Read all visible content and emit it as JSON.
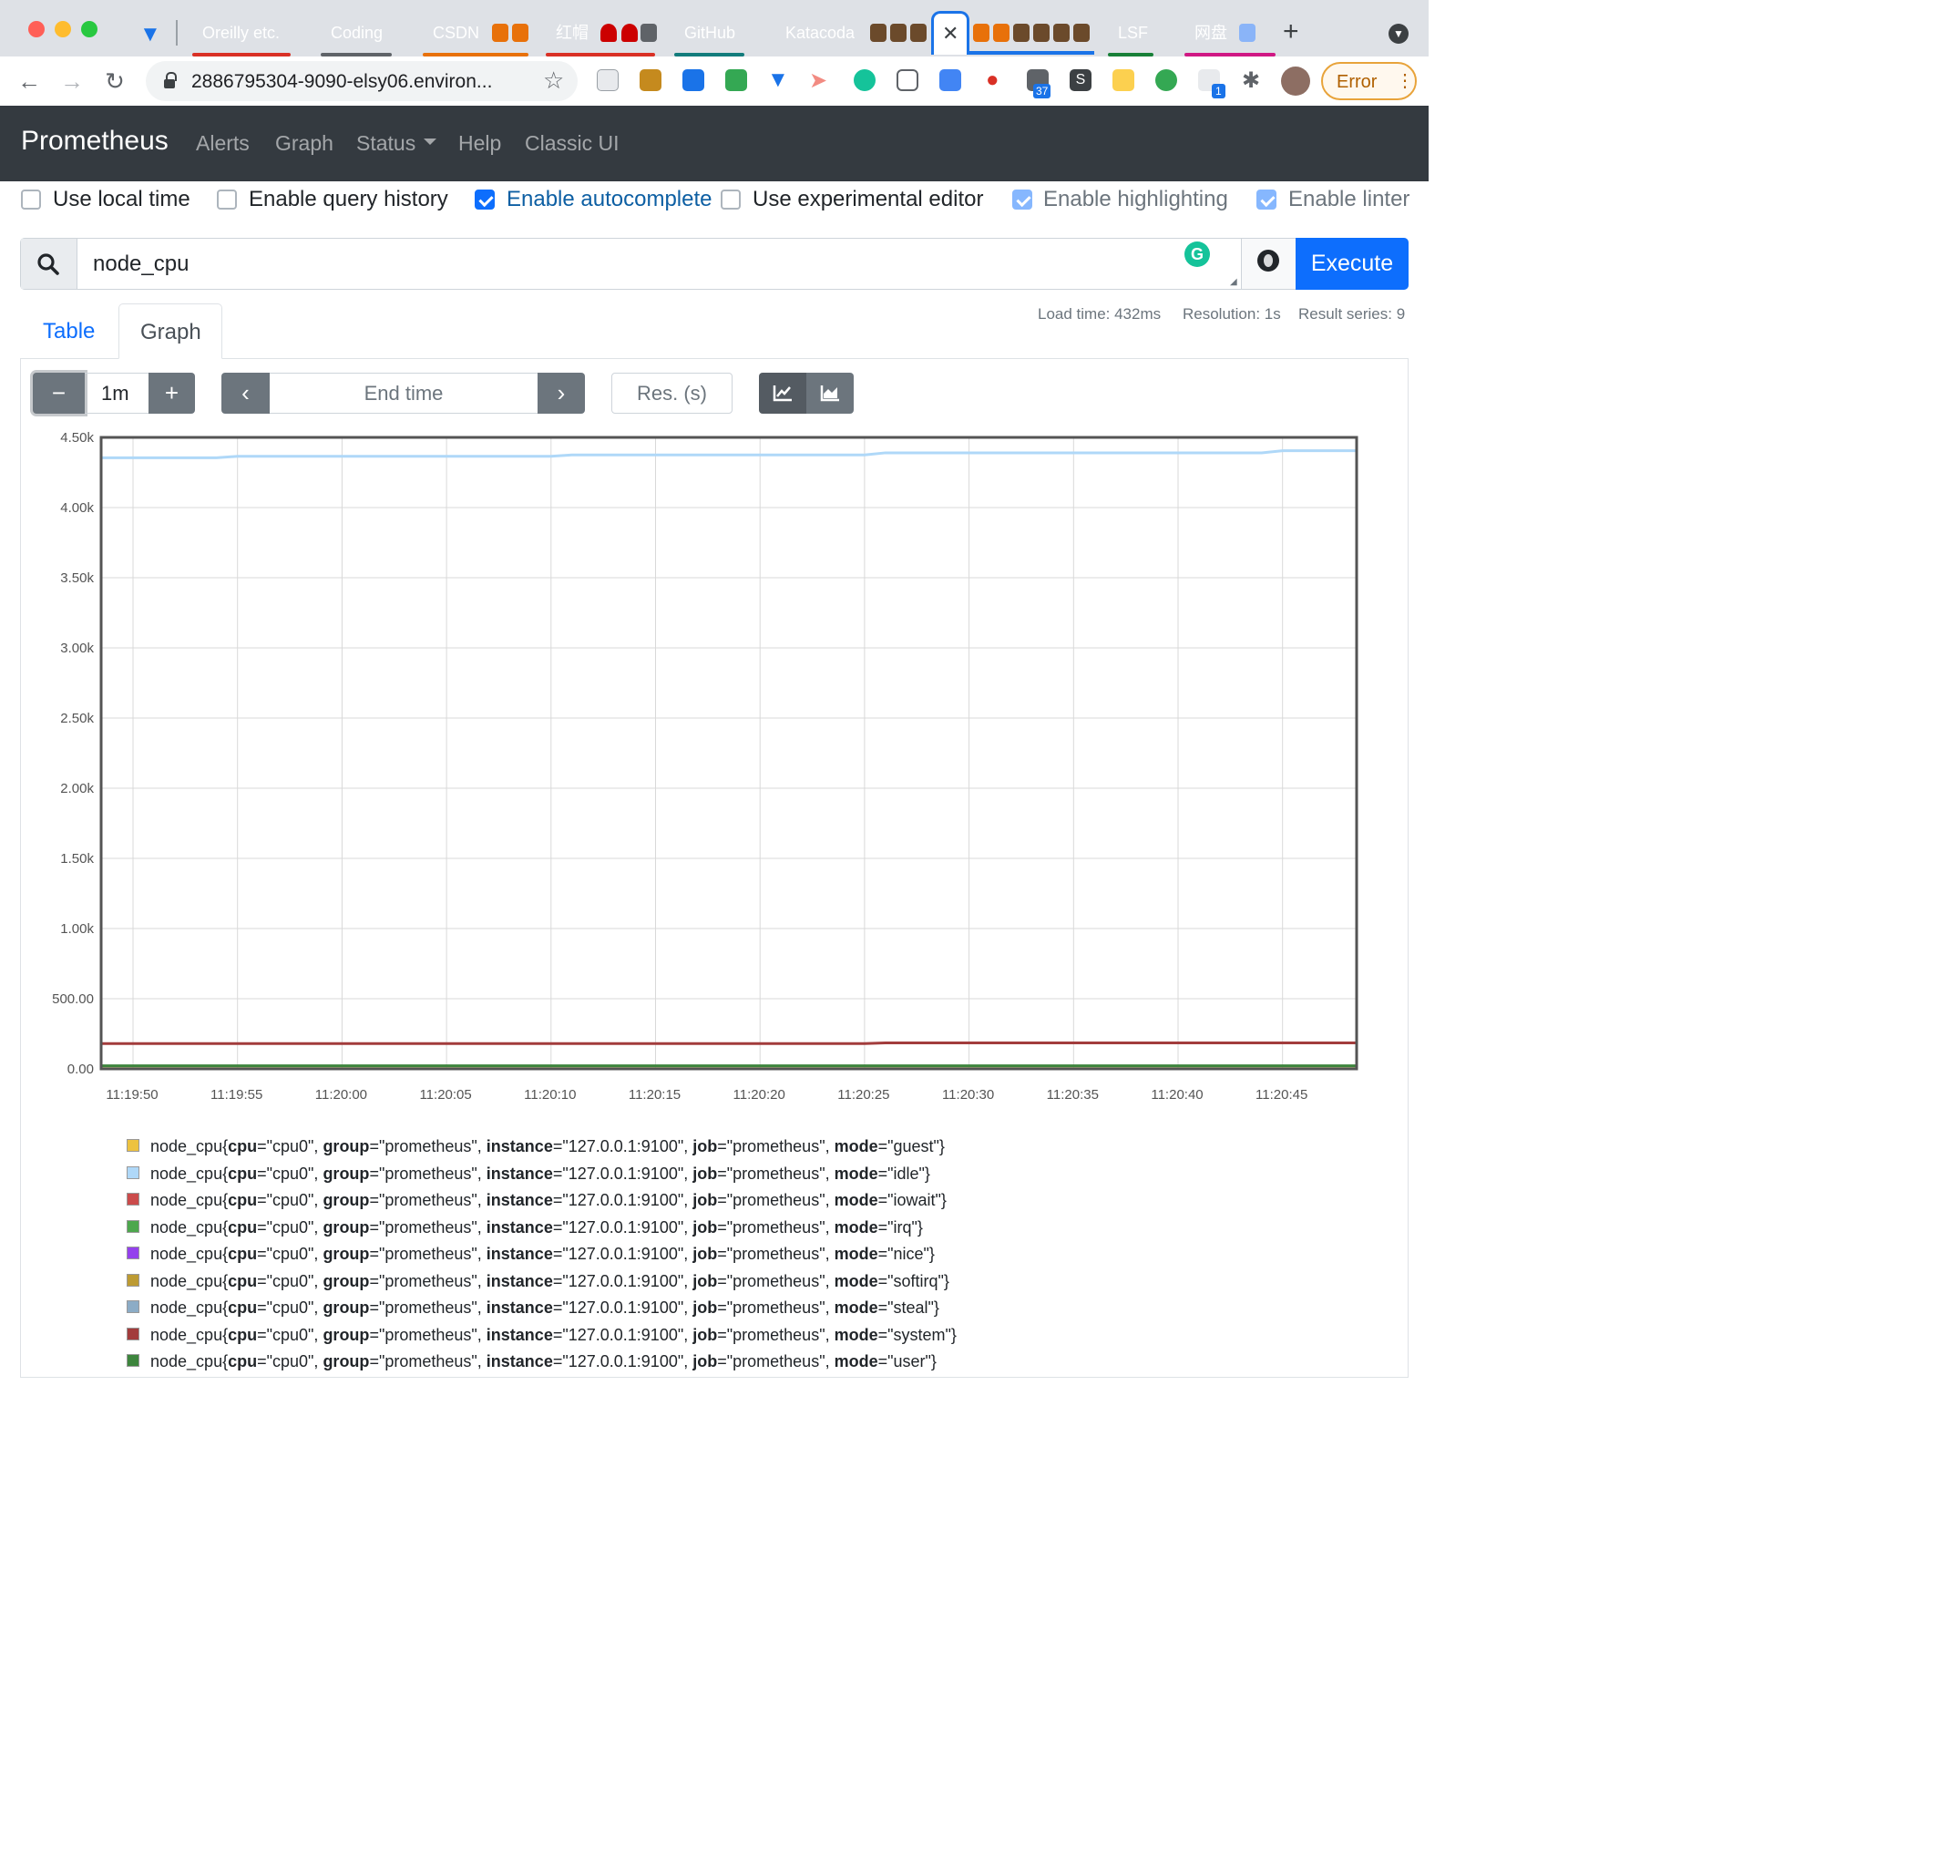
{
  "browser": {
    "tabs": [
      {
        "label": "Oreilly etc.",
        "color": "#d93025"
      },
      {
        "label": "Coding",
        "color": "#5f6368"
      },
      {
        "label": "CSDN",
        "color": "#e8710a"
      },
      {
        "label": "红帽",
        "color": "#d93025"
      },
      {
        "label": "GitHub",
        "color": "#137c7c"
      },
      {
        "label": "Katacoda",
        "color": "#1a73e8"
      },
      {
        "label": "LSF",
        "color": "#188038"
      },
      {
        "label": "网盘",
        "color": "#d01884"
      }
    ],
    "address": "2886795304-9090-elsy06.environ...",
    "ext_badges": {
      "calendar": "37",
      "translate": "1"
    },
    "profile_status": "Error"
  },
  "nav": {
    "brand": "Prometheus",
    "links": [
      "Alerts",
      "Graph",
      "Status",
      "Help",
      "Classic UI"
    ]
  },
  "options": [
    {
      "label": "Use local time",
      "checked": false
    },
    {
      "label": "Enable query history",
      "checked": false
    },
    {
      "label": "Enable autocomplete",
      "checked": true
    },
    {
      "label": "Use experimental editor",
      "checked": false
    },
    {
      "label": "Enable highlighting",
      "checked": true
    },
    {
      "label": "Enable linter",
      "checked": true
    }
  ],
  "query": {
    "value": "node_cpu",
    "execute_label": "Execute"
  },
  "stats": {
    "load_time": "Load time: 432ms",
    "resolution": "Resolution: 1s",
    "result_series": "Result series: 9"
  },
  "panel_tabs": {
    "table": "Table",
    "graph": "Graph",
    "active": "Graph"
  },
  "controls": {
    "range": "1m",
    "end_time_placeholder": "End time",
    "res_placeholder": "Res. (s)"
  },
  "chart_data": {
    "type": "line",
    "ylim": [
      0,
      4500
    ],
    "y_ticks": [
      "0.00",
      "500.00",
      "1.00k",
      "1.50k",
      "2.00k",
      "2.50k",
      "3.00k",
      "3.50k",
      "4.00k",
      "4.50k"
    ],
    "x_ticks": [
      "11:19:50",
      "11:19:55",
      "11:20:00",
      "11:20:05",
      "11:20:10",
      "11:20:15",
      "11:20:20",
      "11:20:25",
      "11:20:30",
      "11:20:35",
      "11:20:40",
      "11:20:45"
    ],
    "x_start_seconds": 48.5,
    "x_end_seconds": 108.5,
    "series": [
      {
        "name": "guest",
        "color": "#edc240",
        "x": [
          48.5,
          108.5
        ],
        "y": [
          0,
          0
        ]
      },
      {
        "name": "idle",
        "color": "#afd8f8",
        "x": [
          48.5,
          54,
          55,
          70,
          71,
          85,
          86,
          104,
          105,
          108.5
        ],
        "y": [
          4355,
          4355,
          4365,
          4365,
          4375,
          4375,
          4390,
          4390,
          4405,
          4405
        ]
      },
      {
        "name": "iowait",
        "color": "#cb4b4b",
        "x": [
          48.5,
          108.5
        ],
        "y": [
          0,
          0
        ]
      },
      {
        "name": "irq",
        "color": "#4da74d",
        "x": [
          48.5,
          108.5
        ],
        "y": [
          0,
          0
        ]
      },
      {
        "name": "nice",
        "color": "#9440ed",
        "x": [
          48.5,
          108.5
        ],
        "y": [
          0,
          0
        ]
      },
      {
        "name": "softirq",
        "color": "#bd9b33",
        "x": [
          48.5,
          108.5
        ],
        "y": [
          2,
          2
        ]
      },
      {
        "name": "steal",
        "color": "#8cacc6",
        "x": [
          48.5,
          108.5
        ],
        "y": [
          0,
          0
        ]
      },
      {
        "name": "system",
        "color": "#a23c3c",
        "x": [
          48.5,
          85,
          86,
          108.5
        ],
        "y": [
          180,
          180,
          185,
          185
        ]
      },
      {
        "name": "user",
        "color": "#3d853d",
        "x": [
          48.5,
          108.5
        ],
        "y": [
          22,
          22
        ]
      }
    ]
  },
  "legend": {
    "metric": "node_cpu",
    "cpu": "cpu0",
    "group": "prometheus",
    "instance": "127.0.0.1:9100",
    "job": "prometheus",
    "modes": [
      "guest",
      "idle",
      "iowait",
      "irq",
      "nice",
      "softirq",
      "steal",
      "system",
      "user"
    ]
  }
}
